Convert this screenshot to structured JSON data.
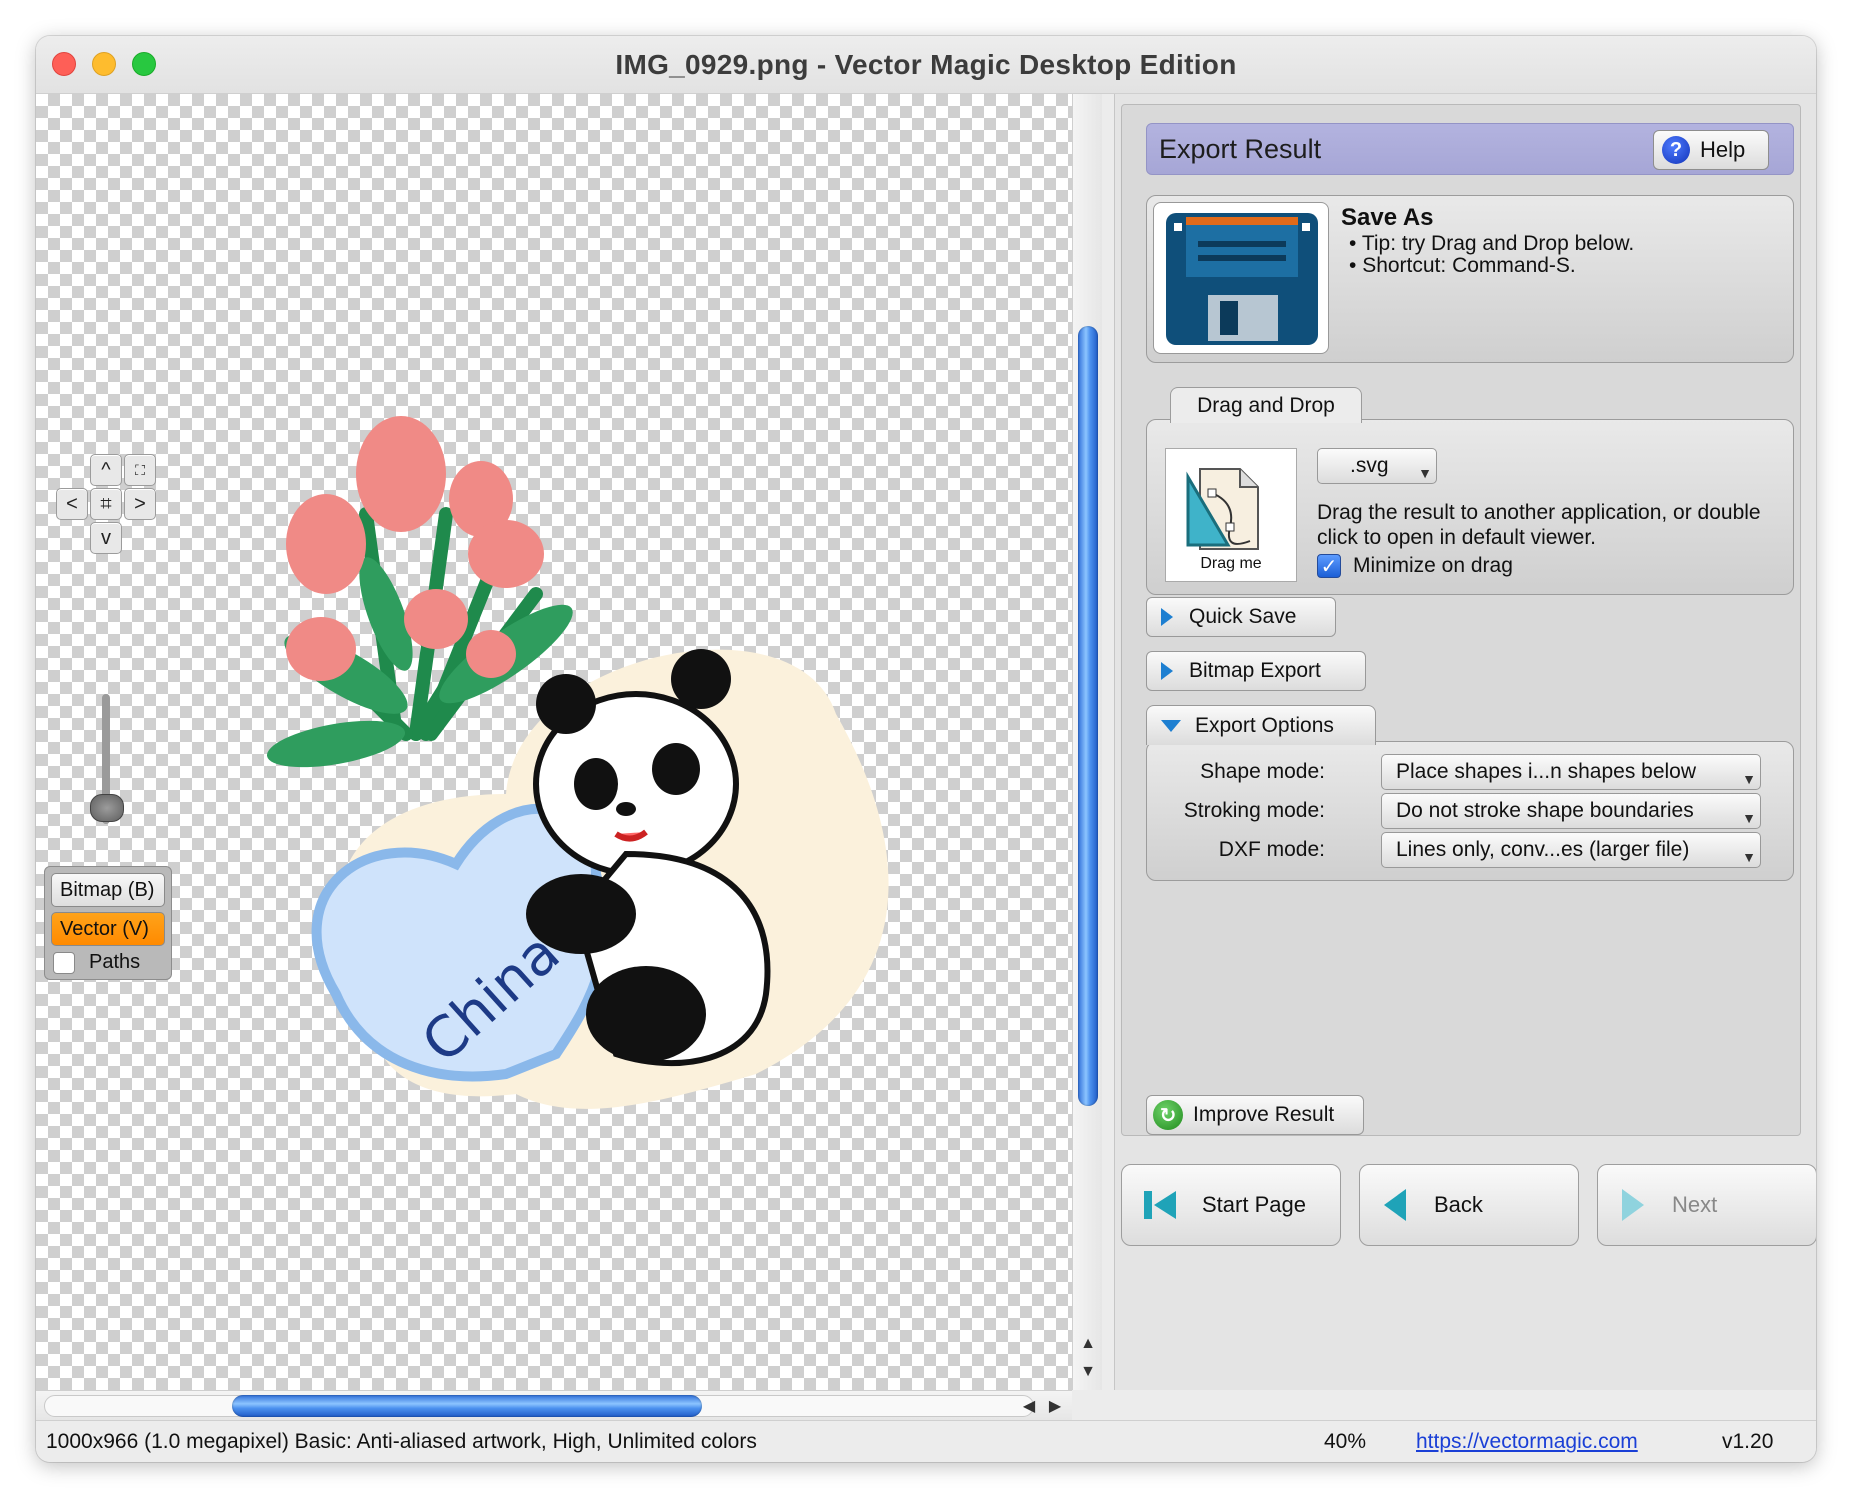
{
  "window": {
    "title": "IMG_0929.png - Vector Magic Desktop Edition"
  },
  "canvas": {
    "nav_buttons": {
      "up": "^",
      "left": "<",
      "center": "⌗",
      "right": ">",
      "down": "v"
    },
    "view_mode": {
      "bitmap_label": "Bitmap (B)",
      "vector_label": "Vector (V)",
      "paths_label": "Paths",
      "paths_checked": false,
      "selected": "vector"
    },
    "artwork_text": "China M"
  },
  "panel": {
    "header_title": "Export Result",
    "help_label": "Help",
    "save_as": {
      "title": "Save As",
      "bullets": [
        "Tip: try Drag and Drop below.",
        "Shortcut: Command-S."
      ]
    },
    "drag_and_drop": {
      "tab_label": "Drag and Drop",
      "drag_label": "Drag me",
      "format": ".svg",
      "description": "Drag the result to another application, or double click to open in default viewer.",
      "minimize_label": "Minimize on drag",
      "minimize_checked": true
    },
    "quick_save_label": "Quick Save",
    "bitmap_export_label": "Bitmap Export",
    "export_options": {
      "label": "Export Options",
      "rows": [
        {
          "label": "Shape mode:",
          "value": "Place shapes i...n shapes below"
        },
        {
          "label": "Stroking mode:",
          "value": "Do not stroke shape boundaries"
        },
        {
          "label": "DXF mode:",
          "value": "Lines only, conv...es (larger file)"
        }
      ]
    },
    "improve_label": "Improve Result",
    "nav": {
      "start": "Start Page",
      "back": "Back",
      "next": "Next"
    }
  },
  "status": {
    "info": "1000x966 (1.0 megapixel)  Basic: Anti-aliased artwork, High, Unlimited colors",
    "zoom": "40%",
    "link": "https://vectormagic.com",
    "version": "v1.20"
  },
  "colors": {
    "accent_orange": "#ff8a00",
    "scroll_blue": "#4d92ef",
    "header_lavender": "#a6a6d6",
    "link_blue": "#1a3fd6"
  }
}
